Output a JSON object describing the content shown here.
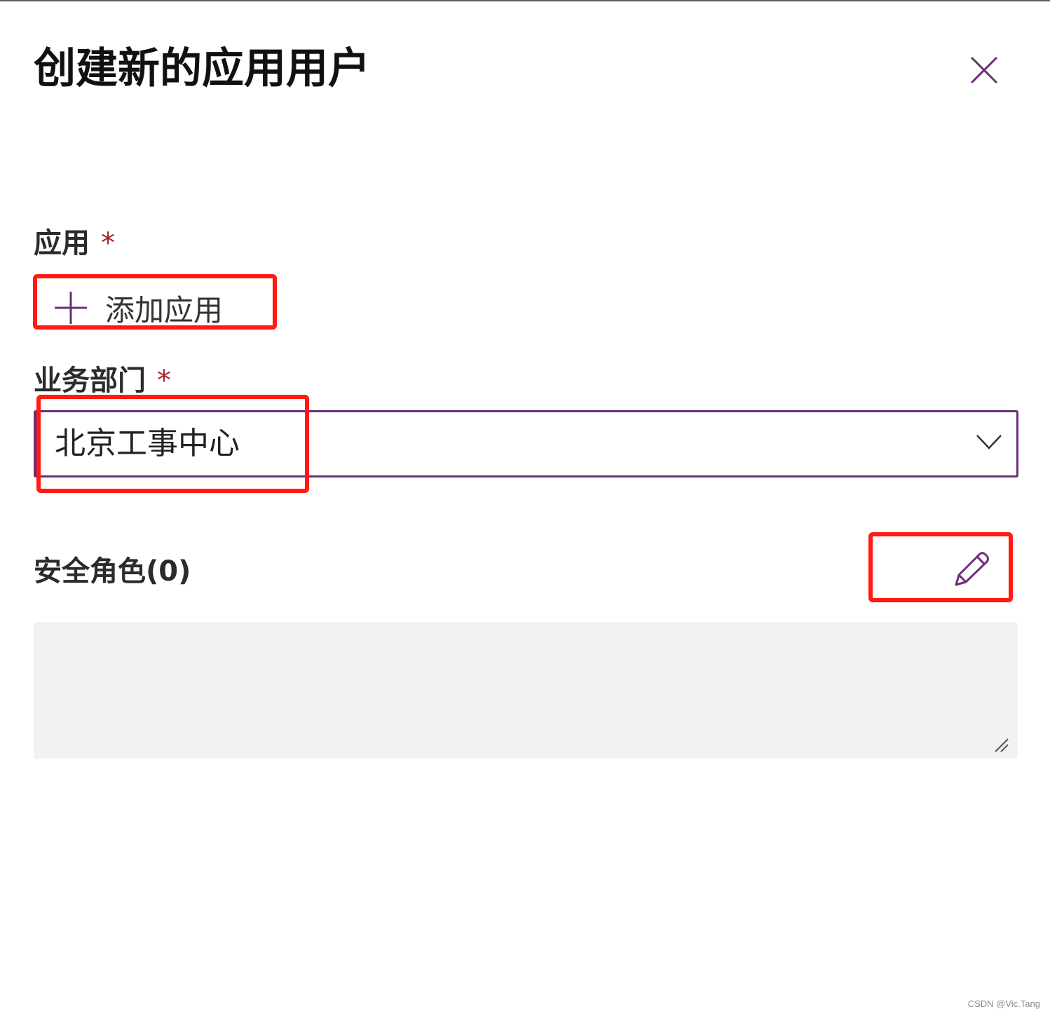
{
  "dialog": {
    "title": "创建新的应用用户",
    "close_icon": "close-icon"
  },
  "fields": {
    "application": {
      "label": "应用",
      "required_marker": "*",
      "add_label": "添加应用",
      "add_icon": "plus-icon"
    },
    "business_unit": {
      "label": "业务部门",
      "required_marker": "*",
      "selected_value": "北京工事中心",
      "chevron_icon": "chevron-down-icon"
    },
    "security_roles": {
      "label": "安全角色(0)",
      "edit_icon": "pencil-icon",
      "resize_icon": "resize-handle-icon"
    }
  },
  "colors": {
    "accent": "#6b2e78",
    "required": "#a4262c",
    "annotation": "#ff1a12",
    "textarea_bg": "#f3f2f1"
  },
  "watermark": "CSDN @Vic.Tang"
}
